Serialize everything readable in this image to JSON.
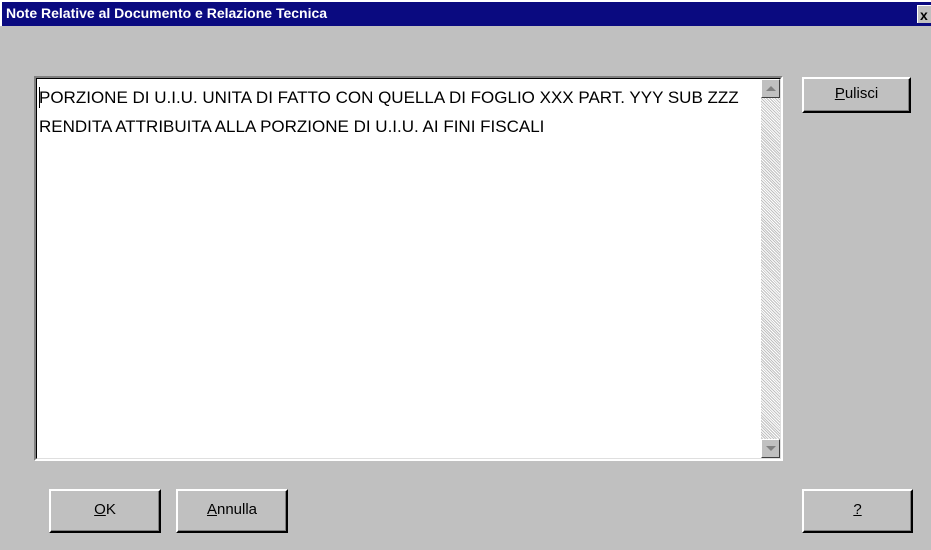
{
  "window": {
    "title": "Note Relative al Documento e Relazione Tecnica",
    "close_label": "x"
  },
  "note": {
    "text": "PORZIONE DI U.I.U. UNITA DI FATTO CON QUELLA DI FOGLIO XXX PART. YYY SUB ZZZ RENDITA ATTRIBUITA ALLA PORZIONE DI U.I.U. AI FINI FISCALI"
  },
  "buttons": {
    "clear": {
      "mnemonic": "P",
      "rest": "ulisci"
    },
    "ok": {
      "mnemonic": "O",
      "rest": "K"
    },
    "cancel": {
      "mnemonic": "A",
      "rest": "nnulla"
    },
    "help": {
      "mnemonic": "?",
      "rest": ""
    }
  },
  "icons": {
    "close": "close-icon",
    "scroll_up": "scroll-up-arrow-icon",
    "scroll_down": "scroll-down-arrow-icon"
  },
  "colors": {
    "titlebar": "#0a0a80",
    "window_bg": "#c0c0c0",
    "text_area_bg": "#ffffff"
  }
}
